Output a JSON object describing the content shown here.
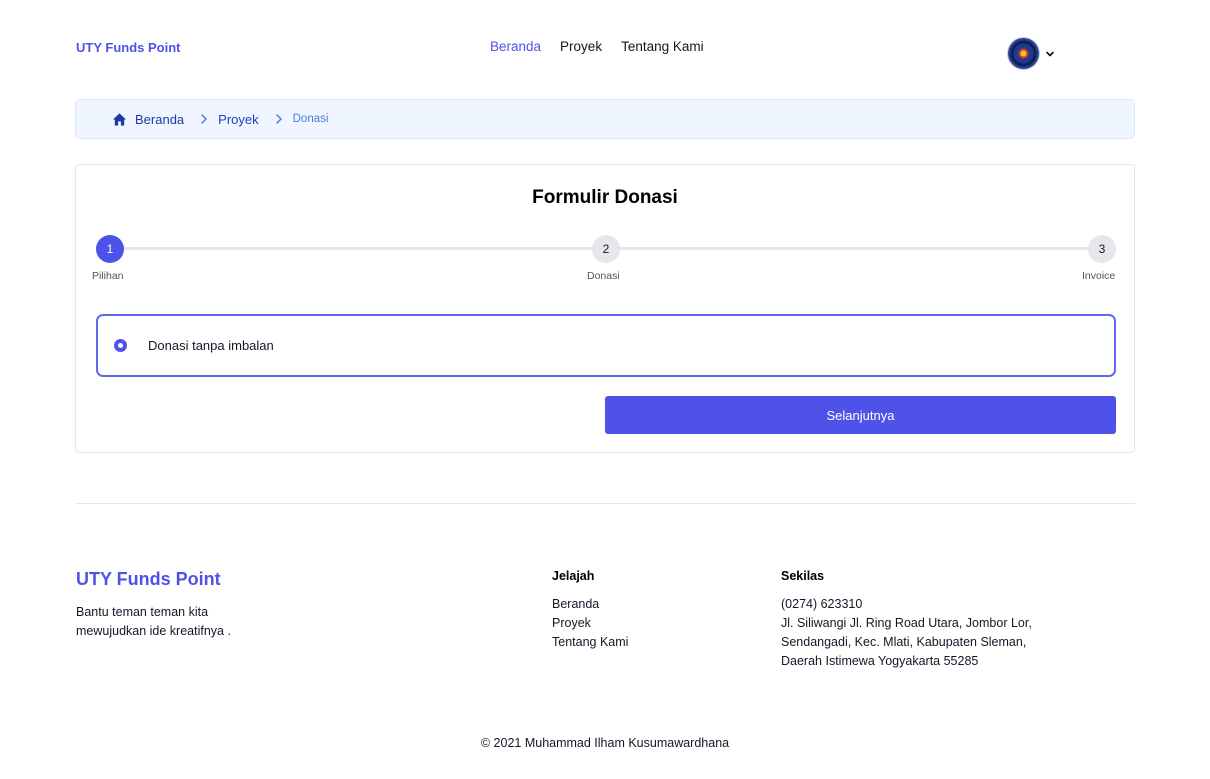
{
  "navbar": {
    "brand": "UTY Funds Point",
    "links": [
      {
        "label": "Beranda",
        "active": true
      },
      {
        "label": "Proyek",
        "active": false
      },
      {
        "label": "Tentang Kami",
        "active": false
      }
    ]
  },
  "breadcrumb": {
    "items": [
      "Beranda",
      "Proyek"
    ],
    "current": "Donasi"
  },
  "form": {
    "title": "Formulir Donasi",
    "steps": [
      {
        "number": "1",
        "label": "Pilihan",
        "active": true
      },
      {
        "number": "2",
        "label": "Donasi",
        "active": false
      },
      {
        "number": "3",
        "label": "Invoice",
        "active": false
      }
    ],
    "option_label": "Donasi tanpa imbalan",
    "next_label": "Selanjutnya"
  },
  "footer": {
    "brand": "UTY Funds Point",
    "tagline": "Bantu teman teman kita mewujudkan ide kreatifnya .",
    "explore": {
      "title": "Jelajah",
      "links": [
        "Beranda",
        "Proyek",
        "Tentang Kami"
      ]
    },
    "info": {
      "title": "Sekilas",
      "phone": "(0274) 623310",
      "address": "Jl. Siliwangi Jl. Ring Road Utara, Jombor Lor, Sendangadi, Kec. Mlati, Kabupaten Sleman, Daerah Istimewa Yogyakarta 55285"
    },
    "copyright": "© 2021 Muhammad Ilham Kusumawardhana"
  },
  "colors": {
    "accent": "#4f52e8",
    "breadcrumb_bg": "#eff6ff",
    "step_inactive": "#e5e7eb"
  },
  "icons": [
    "home-icon",
    "chevron-right-icon",
    "chevron-down-icon",
    "avatar-icon"
  ]
}
